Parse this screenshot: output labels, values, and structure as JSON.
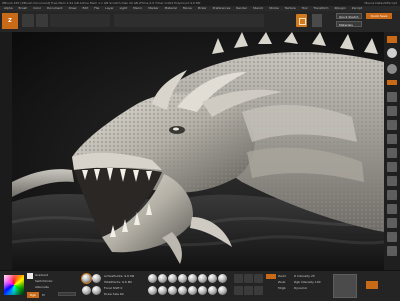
{
  "titlebar": {
    "title": "ZBrush 4R7   [ZBrush Document]   Free Mem 2.91 GB  Active Mem 1.1 GB  Scratch Disk 40 GB  ZTime 2.0  Timer 0.002  PolyCount 9.6 MP",
    "right": "Menus  DefaultZScript"
  },
  "menus": [
    "Alpha",
    "Brush",
    "Color",
    "Document",
    "Draw",
    "Edit",
    "File",
    "Layer",
    "Light",
    "Macro",
    "Marker",
    "Material",
    "Movie",
    "Picker",
    "Preferences",
    "Render",
    "Stencil",
    "Stroke",
    "Texture",
    "Tool",
    "Transform",
    "Zplugin",
    "Zscript"
  ],
  "toolbar": {
    "logo": "Z",
    "dropdown_top": "Quick Sketch",
    "dropdown_bottom": "Materials",
    "orange_tab": "Quick Save"
  },
  "bottom": {
    "label_gradient": "Gradient",
    "label_switch": "SwitchColor",
    "label_alternate": "Alternate",
    "label_rgb": "Rgb",
    "label_m": "M",
    "label_rgb_intensity": "Rgb Intensity 100",
    "label_z_intensity": "Z Intensity 25",
    "label_focal": "Focal Shift 0",
    "label_draw_size": "Draw Size 64",
    "label_dynamic": "Dynamic",
    "label_active_points": "ActivePoints: 9.6 Mil",
    "label_total_points": "TotalPoints: 9.6 Mil",
    "label_zadd": "Zadd",
    "label_zsub": "Zsub",
    "label_mrgb": "Mrgb"
  },
  "colors": {
    "accent": "#c96a19",
    "panel": "#242424",
    "canvas": "#1a1a1a"
  }
}
